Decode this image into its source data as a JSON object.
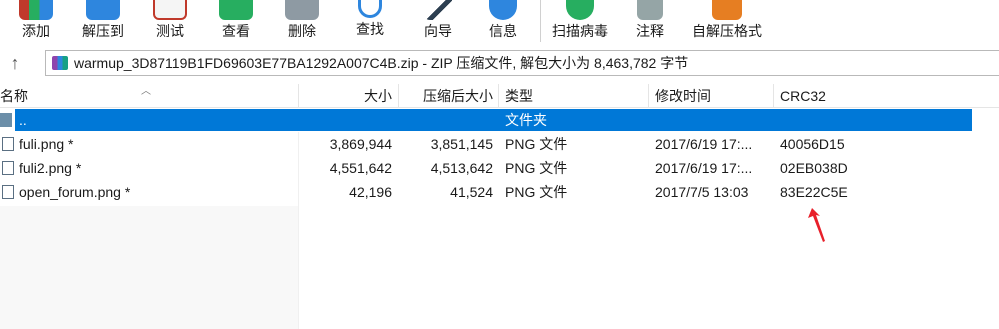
{
  "toolbar": {
    "buttons": [
      {
        "label": "添加",
        "icon": "add-archive-icon",
        "color": "#c0392b"
      },
      {
        "label": "解压到",
        "icon": "extract-to-icon",
        "color": "#2e86de"
      },
      {
        "label": "测试",
        "icon": "test-icon",
        "color": "#c0392b"
      },
      {
        "label": "查看",
        "icon": "view-book-icon",
        "color": "#27ae60"
      },
      {
        "label": "删除",
        "icon": "delete-icon",
        "color": "#7f8c8d"
      },
      {
        "label": "查找",
        "icon": "find-magnifier-icon",
        "color": "#2e86de"
      },
      {
        "label": "向导",
        "icon": "wizard-wand-icon",
        "color": "#2c3e50"
      },
      {
        "label": "信息",
        "icon": "info-icon",
        "color": "#2e86de"
      },
      {
        "label": "扫描病毒",
        "icon": "virus-scan-icon",
        "color": "#27ae60"
      },
      {
        "label": "注释",
        "icon": "comment-icon",
        "color": "#7f8c8d"
      },
      {
        "label": "自解压格式",
        "icon": "sfx-box-icon",
        "color": "#e67e22"
      }
    ]
  },
  "address": {
    "text": "warmup_3D87119B1FD69603E77BA1292A007C4B.zip - ZIP 压缩文件, 解包大小为 8,463,782 字节"
  },
  "columns": {
    "name": "名称",
    "size": "大小",
    "packed": "压缩后大小",
    "type": "类型",
    "modified": "修改时间",
    "crc": "CRC32"
  },
  "rows": [
    {
      "name": "..",
      "size": "",
      "packed": "",
      "type": "文件夹",
      "modified": "",
      "crc": ""
    },
    {
      "name": "fuli.png *",
      "size": "3,869,944",
      "packed": "3,851,145",
      "type": "PNG 文件",
      "modified": "2017/6/19 17:...",
      "crc": "40056D15"
    },
    {
      "name": "fuli2.png *",
      "size": "4,551,642",
      "packed": "4,513,642",
      "type": "PNG 文件",
      "modified": "2017/6/19 17:...",
      "crc": "02EB038D"
    },
    {
      "name": "open_forum.png *",
      "size": "42,196",
      "packed": "41,524",
      "type": "PNG 文件",
      "modified": "2017/7/5 13:03",
      "crc": "83E22C5E"
    }
  ],
  "colors": {
    "selection": "#0078d7",
    "annotation_arrow": "#e8202a"
  }
}
